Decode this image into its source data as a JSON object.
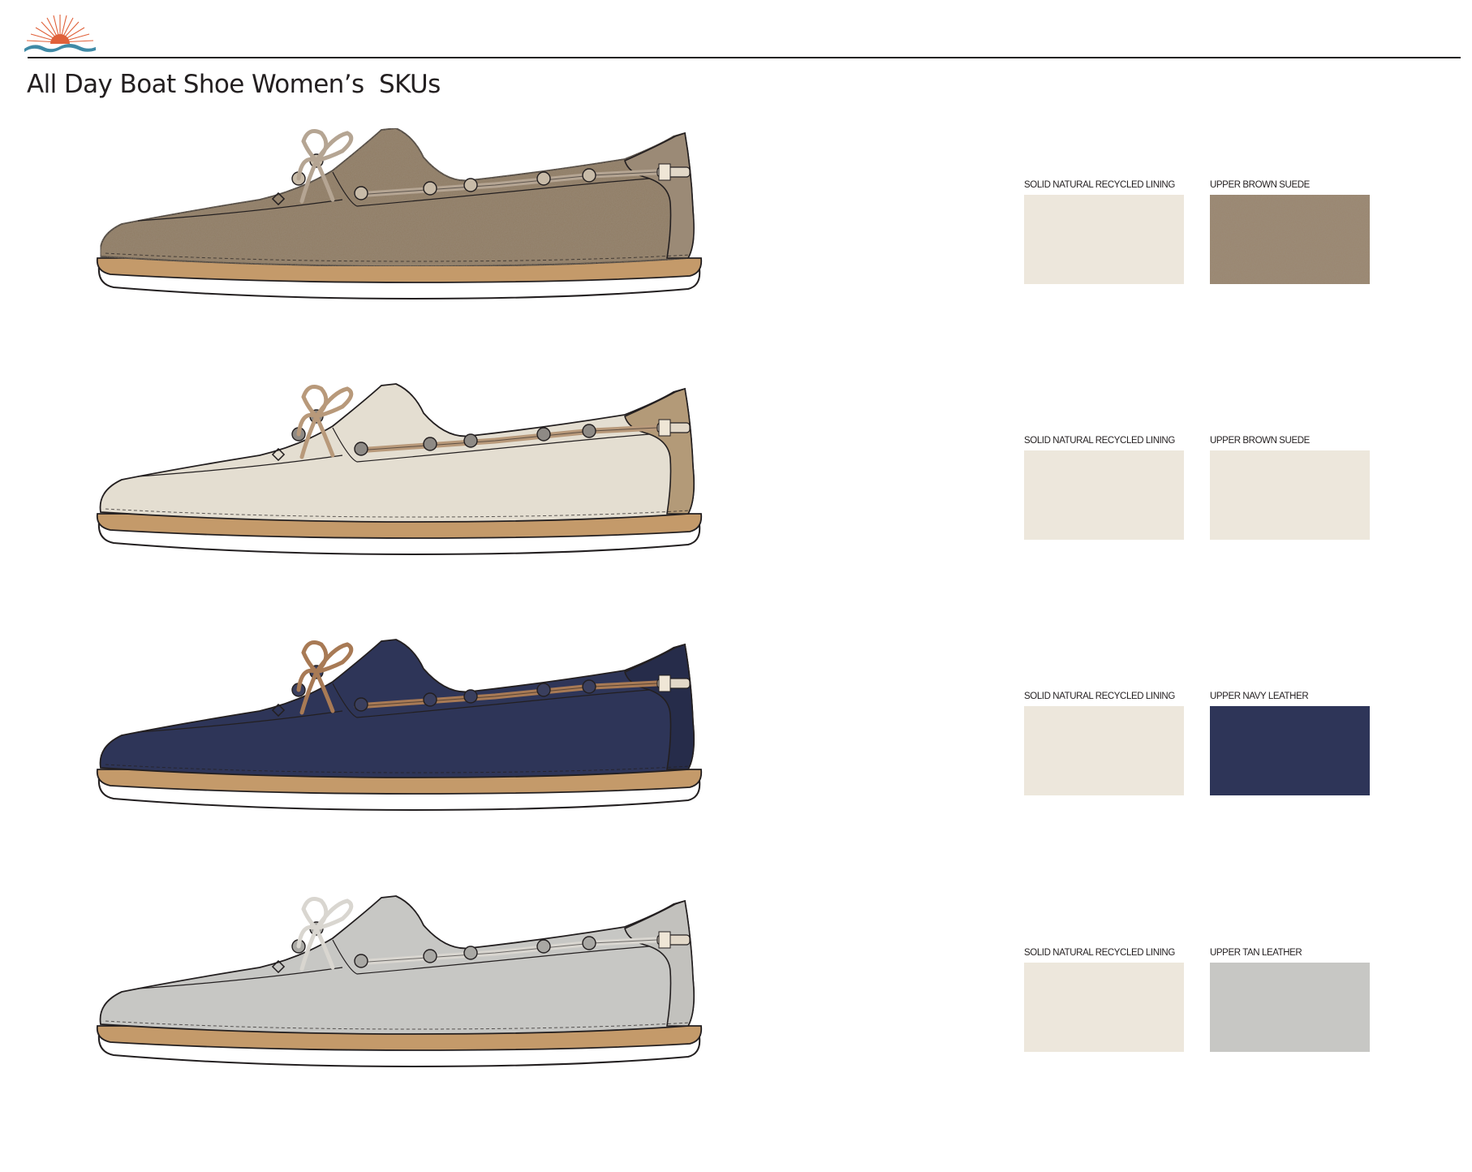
{
  "page": {
    "title": "All Day Boat Shoe Women’s  SKUs"
  },
  "logo": {
    "name": "sunrise-logo",
    "colors": {
      "sun": "#e0613a",
      "rays": "#e0613a",
      "wave": "#3f8aa6"
    }
  },
  "skus": [
    {
      "lining": {
        "label": "SOLID NATURAL RECYCLED LINING",
        "color": "#ede7dc"
      },
      "upper": {
        "label": "UPPER BROWN SUEDE",
        "color": "#9a8670",
        "texture": "suede"
      },
      "shoe_colors": {
        "upper": "#8f7b63",
        "heel": "#9b8a76",
        "lace": "#b5a593",
        "eyelet": "#c8bba8"
      }
    },
    {
      "lining": {
        "label": "SOLID NATURAL RECYCLED LINING",
        "color": "#ede7dc"
      },
      "upper": {
        "label": "UPPER BROWN SUEDE",
        "color": "#ede7dc"
      },
      "shoe_colors": {
        "upper": "#e4ded1",
        "heel": "#b39a78",
        "lace": "#b8997a",
        "eyelet": "#8e8a85"
      }
    },
    {
      "lining": {
        "label": "SOLID NATURAL RECYCLED LINING",
        "color": "#ede7dc"
      },
      "upper": {
        "label": "UPPER NAVY LEATHER",
        "color": "#2e3558"
      },
      "shoe_colors": {
        "upper": "#2e3558",
        "heel": "#262c4a",
        "lace": "#a87a55",
        "eyelet": "#3a3f5e"
      }
    },
    {
      "lining": {
        "label": "SOLID NATURAL RECYCLED LINING",
        "color": "#ede7dc"
      },
      "upper": {
        "label": "UPPER TAN LEATHER",
        "color": "#c7c7c4"
      },
      "shoe_colors": {
        "upper": "#c7c7c4",
        "heel": "#c2c1bd",
        "lace": "#d9d6d0",
        "eyelet": "#a9a8a4"
      }
    }
  ],
  "sole_colors": {
    "midsole": "#c49a6a",
    "outsole": "#ffffff"
  }
}
